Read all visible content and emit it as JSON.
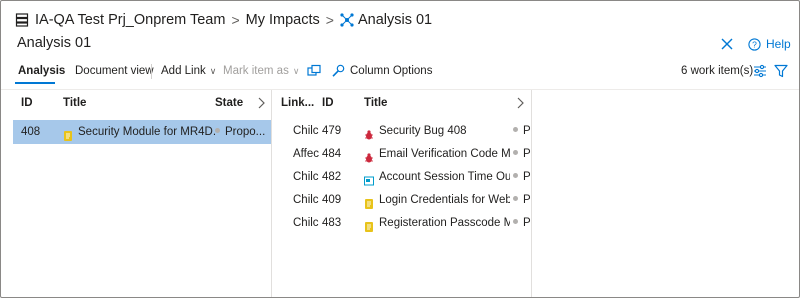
{
  "breadcrumb": {
    "project": "IA-QA Test Prj_Onprem Team",
    "impacts": "My Impacts",
    "current": "Analysis 01",
    "separator": ">"
  },
  "page": {
    "title": "Analysis 01",
    "help_label": "Help"
  },
  "toolbar": {
    "tabs": [
      "Analysis",
      "Document view"
    ],
    "add_link": "Add Link",
    "mark_item_as": "Mark item as",
    "column_options": "Column Options",
    "work_item_count": "6 work item(s)",
    "chevron": "∨"
  },
  "left_pane": {
    "columns": [
      "ID",
      "Title",
      "State"
    ],
    "rows": [
      {
        "id": "408",
        "title": "Security Module for MR4D...",
        "state": "Propo...",
        "type": "requirement",
        "selected": true
      }
    ]
  },
  "middle_pane": {
    "columns": [
      "Link...",
      "ID",
      "Title"
    ],
    "rows": [
      {
        "link": "Chilc",
        "id": "479",
        "title": "Security Bug 408",
        "state": "Pr",
        "type": "bug"
      },
      {
        "link": "Affec",
        "id": "484",
        "title": "Email Verification Code Mo...",
        "state": "Pr",
        "type": "bug"
      },
      {
        "link": "Chilc",
        "id": "482",
        "title": "Account Session Time Out",
        "state": "Pr",
        "type": "feature"
      },
      {
        "link": "Chilc",
        "id": "409",
        "title": "Login Credentials for Website",
        "state": "Pr",
        "type": "requirement"
      },
      {
        "link": "Chilc",
        "id": "483",
        "title": "Registeration Passcode Mo...",
        "state": "Pr",
        "type": "requirement"
      }
    ]
  },
  "colors": {
    "accent": "#0078d4",
    "selected_row": "#a6c8ea",
    "bug": "#cc293d",
    "requirement": "#e8c31a",
    "feature": "#009ccc"
  }
}
